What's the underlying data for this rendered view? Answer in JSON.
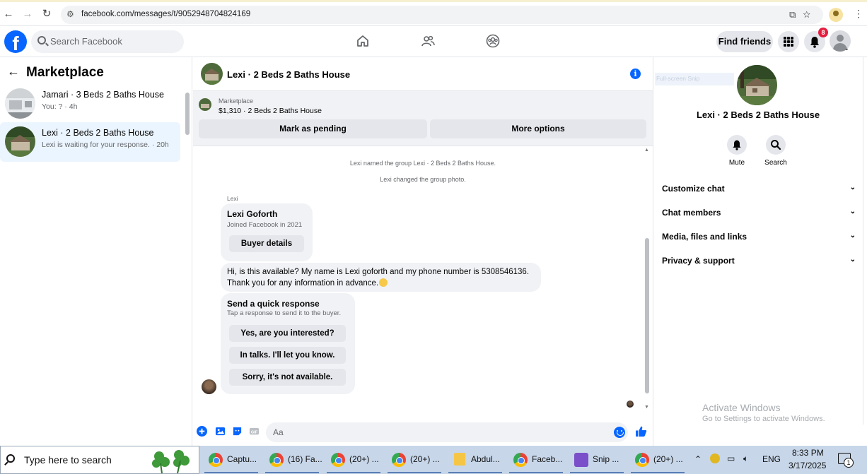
{
  "browser": {
    "url": "facebook.com/messages/t/9052948704824169"
  },
  "fb_header": {
    "search_placeholder": "Search Facebook",
    "find_friends": "Find friends",
    "notification_count": "8"
  },
  "left": {
    "title": "Marketplace",
    "conversations": [
      {
        "title": "Jamari · 3 Beds 2 Baths House",
        "subtitle": "You: ? · 4h"
      },
      {
        "title": "Lexi · 2 Beds 2 Baths House",
        "subtitle": "Lexi is waiting for your response. · 20h"
      }
    ]
  },
  "chat": {
    "title": "Lexi · 2 Beds 2 Baths House",
    "marketplace_label": "Marketplace",
    "listing": "$1,310 · 2 Beds 2 Baths House",
    "mark_pending": "Mark as pending",
    "more_options": "More options",
    "system_messages": [
      "Lexi named the group Lexi · 2 Beds 2 Baths House.",
      "Lexi changed the group photo."
    ],
    "sender": "Lexi",
    "profile_card": {
      "name": "Lexi Goforth",
      "joined": "Joined Facebook in 2021",
      "button": "Buyer details"
    },
    "message_lines": [
      "Hi, is this available? My name is Lexi goforth and my phone number is 5308546136.",
      "Thank you for any information in advance."
    ],
    "quick_response": {
      "title": "Send a quick response",
      "subtitle": "Tap a response to send it to the buyer.",
      "options": [
        "Yes, are you interested?",
        "In talks. I'll let you know.",
        "Sorry, it's not available."
      ]
    },
    "composer_placeholder": "Aa"
  },
  "right": {
    "title": "Lexi · 2 Beds 2 Baths House",
    "ghost_tooltip": "Full-screen Snip",
    "actions": [
      {
        "label": "Mute",
        "icon": "bell-icon"
      },
      {
        "label": "Search",
        "icon": "search-icon"
      }
    ],
    "sections": [
      "Customize chat",
      "Chat members",
      "Media, files and links",
      "Privacy & support"
    ],
    "watermark_title": "Activate Windows",
    "watermark_sub": "Go to Settings to activate Windows."
  },
  "taskbar": {
    "search_placeholder": "Type here to search",
    "items": [
      {
        "label": "Captu...",
        "icon": "chrome-icon"
      },
      {
        "label": "(16) Fa...",
        "icon": "chrome-icon"
      },
      {
        "label": "(20+) ...",
        "icon": "chrome-icon"
      },
      {
        "label": "(20+) ...",
        "icon": "chrome-icon"
      },
      {
        "label": "Abdul...",
        "icon": "folder-icon"
      },
      {
        "label": "Faceb...",
        "icon": "chrome-icon"
      },
      {
        "label": "Snip ...",
        "icon": "snip-icon"
      },
      {
        "label": "(20+) ...",
        "icon": "chrome-icon"
      }
    ],
    "language": "ENG",
    "time": "8:33 PM",
    "date": "3/17/2025",
    "notification_count": "1"
  },
  "colors": {
    "fb_blue": "#0866ff",
    "badge_red": "#e41e3f",
    "bubble": "#f0f2f5"
  }
}
